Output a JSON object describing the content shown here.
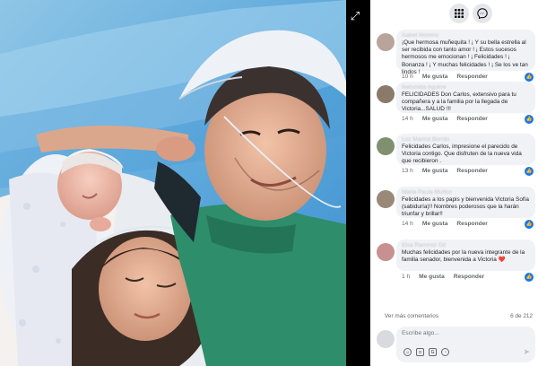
{
  "header": {
    "menu_icon": "grid-menu-icon",
    "messenger_icon": "messenger-icon"
  },
  "photo": {
    "expand_icon": "expand-icon"
  },
  "comments": [
    {
      "author": "Isabel Moreno",
      "text": "¡Que hermosa muñequita ! ¡ Y su bella estrella al ser recibida con tanto amor ! ¡ Estos sucesos hermosos me emocionan ! ¡ Felicidades ! ¡ Bonanza ! ¡ Y muchas felicidades ! ¡ Se los ve tan lindos !",
      "time": "10 h",
      "like": "Me gusta",
      "reply": "Responder",
      "avatar_color": "#b8a49a"
    },
    {
      "author": "Nelsmida Aguirre",
      "text": "FELICIDADES Don Carlos, extensivo para tu compañera y a la familia por la llegada de Victoria...SALUD !!!",
      "time": "14 h",
      "like": "Me gusta",
      "reply": "Responder",
      "avatar_color": "#8a7a6a"
    },
    {
      "author": "Luz Marina Borrás",
      "text": "Felicidades Carlos, impresione el parecido de Victoria contigo. Que disfruten de la nueva vida que recibieron .",
      "time": "13 h",
      "like": "Me gusta",
      "reply": "Responder",
      "avatar_color": "#7f8f6f"
    },
    {
      "author": "Maria Paula Muñoz",
      "text": "Felicidades a los papis y bienvenida Victoria Sofía (sabiduría)!! Nombres poderosos que la harán triunfar y brillar!!",
      "time": "14 h",
      "like": "Me gusta",
      "reply": "Responder",
      "avatar_color": "#9a8878"
    },
    {
      "author": "Elsa Ramírez Gil",
      "text": "Muchas felicidades por la nueva integrante de la familia senador, bienvenida a Victoria ❤️",
      "time": "1 h",
      "like": "Me gusta",
      "reply": "Responder",
      "avatar_color": "#c89090"
    }
  ],
  "footer": {
    "more_comments": "Ver más comentarios",
    "pager": "6 de 212"
  },
  "composer": {
    "placeholder": "Escribe algo...",
    "icons": [
      "emoji-icon",
      "camera-icon",
      "gif-icon",
      "sticker-icon",
      "send-icon"
    ]
  },
  "colors": {
    "facebook_blue": "#1877f2",
    "bubble_bg": "#f0f2f5",
    "meta_text": "#65676b"
  }
}
